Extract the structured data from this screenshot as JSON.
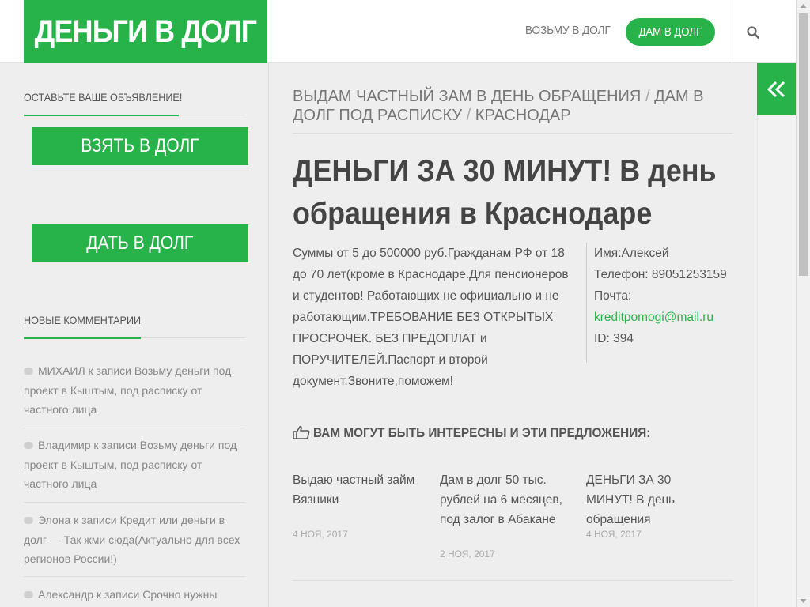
{
  "header": {
    "logo": "ДЕНЬГИ В ДОЛГ",
    "nav_borrow": "ВОЗЬМУ В ДОЛГ",
    "nav_lend": "ДАМ В ДОЛГ"
  },
  "sidebar": {
    "ad_title": "ОСТАВЬТЕ ВАШЕ ОБЪЯВЛЕНИЕ!",
    "btn_take": "ВЗЯТЬ В ДОЛГ",
    "btn_give": "ДАТЬ В ДОЛГ",
    "comments_title": "НОВЫЕ КОММЕНТАРИИ",
    "comments": [
      {
        "text": "МИХАИЛ к записи Возьму деньги под проект в Кыштым, под расписку от частного лица"
      },
      {
        "text": "Владимир к записи Возьму деньги под проект в Кыштым, под расписку от частного лица"
      },
      {
        "text": "Элона к записи Кредит или деньги в долг — Так жми сюда(Актуально для всех регионов России!)"
      },
      {
        "text": "Александр к записи Срочно нужны деньги"
      }
    ]
  },
  "breadcrumb": {
    "part1": "ВЫДАМ ЧАСТНЫЙ ЗАМ В ДЕНЬ ОБРАЩЕНИЯ",
    "part2": "ДАМ В ДОЛГ ПОД РАСПИСКУ",
    "part3": "КРАСНОДАР",
    "sep": "/"
  },
  "post": {
    "title": "ДЕНЬГИ ЗА 30 МИНУТ! В день обращения в Краснодаре",
    "description": "Суммы от 5 до 500000 руб.Гражданам РФ от 18 до 70 лет(кроме в Краснодаре.Для пенсионеров и студентов! Работающих не официально и не работающим.ТРЕБОВАНИЕ БЕЗ ОТКРЫТЫХ ПРОСРОЧЕК. БЕЗ ПРЕДОПЛАТ и ПОРУЧИТЕЛЕЙ.Паспорт и второй документ.Звоните,поможем!",
    "contact": {
      "name": "Имя:Алексей",
      "phone": "Телефон: 89051253159",
      "mail_label": "Почта:",
      "mail": "kreditpomogi@mail.ru",
      "id": "ID: 394"
    }
  },
  "related": {
    "title": "ВАМ МОГУТ БЫТЬ ИНТЕРЕСНЫ И ЭТИ ПРЕДЛОЖЕНИЯ:",
    "items": [
      {
        "title": "Выдаю частный займ Вязники",
        "date": "4 НОЯ, 2017"
      },
      {
        "title": "Дам в долг 50 тыс. рублей на 6 месяцев, под залог в Абакане",
        "date": "2 НОЯ, 2017"
      },
      {
        "title": "ДЕНЬГИ ЗА 30 МИНУТ! В день обращения",
        "date": "4 НОЯ, 2017"
      }
    ]
  },
  "colors": {
    "accent": "#27b24a",
    "background": "#eeeeee"
  },
  "icons": {
    "search": "search-icon",
    "toggle": "double-chevron-left-icon",
    "thumbs": "thumbs-up-icon",
    "comment": "comment-icon"
  }
}
